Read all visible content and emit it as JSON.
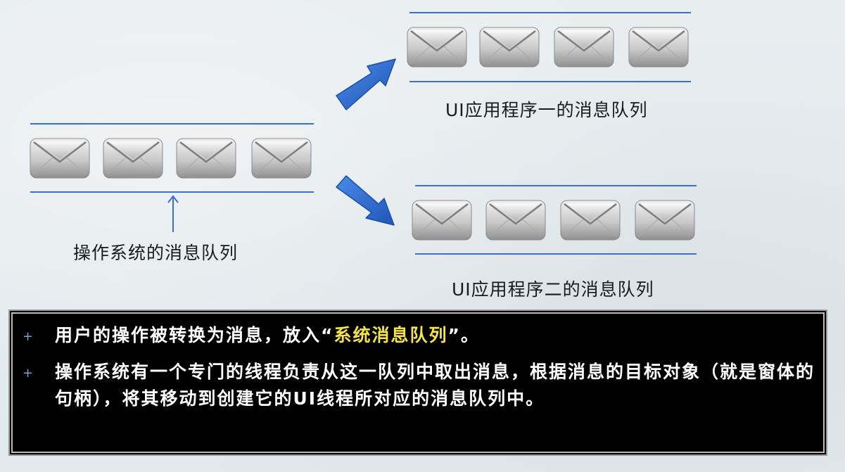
{
  "queues": {
    "os": {
      "label": "操作系统的消息队列"
    },
    "app1": {
      "label": "UI应用程序一的消息队列"
    },
    "app2": {
      "label": "UI应用程序二的消息队列"
    }
  },
  "notes": [
    {
      "prefix": "用户的操作被转换为消息，放入“",
      "highlight": "系统消息队列",
      "suffix": "”。"
    },
    {
      "text": "操作系统有一个专门的线程负责从这一队列中取出消息，根据消息的目标对象（就是窗体的句柄），将其移动到创建它的UI线程所对应的消息队列中。"
    }
  ],
  "colors": {
    "queue_line": "#3b6fd0",
    "arrow": "#2f6fd0",
    "highlight": "#f4e44a",
    "notes_bg": "#000000"
  },
  "icons": {
    "message": "envelope-icon",
    "bullet": "plus"
  }
}
